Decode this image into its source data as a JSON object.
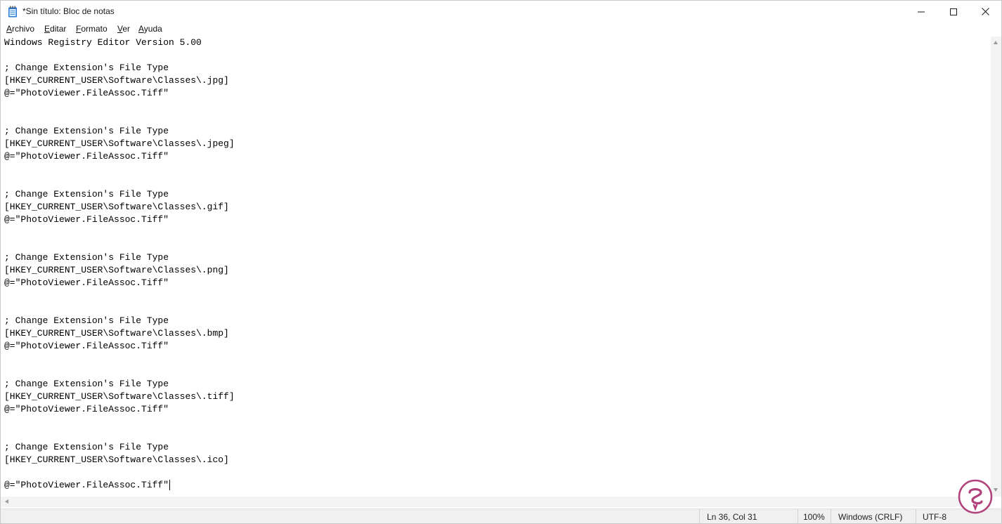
{
  "window": {
    "title": "*Sin título: Bloc de notas"
  },
  "menu": {
    "items": [
      {
        "label": "Archivo",
        "accel": "A",
        "rest": "rchivo"
      },
      {
        "label": "Editar",
        "accel": "E",
        "rest": "ditar"
      },
      {
        "label": "Formato",
        "accel": "F",
        "rest": "ormato"
      },
      {
        "label": "Ver",
        "accel": "V",
        "rest": "er"
      },
      {
        "label": "Ayuda",
        "accel": "A",
        "rest": "yuda"
      }
    ]
  },
  "editor": {
    "lines": [
      "Windows Registry Editor Version 5.00",
      "",
      "; Change Extension's File Type",
      "[HKEY_CURRENT_USER\\Software\\Classes\\.jpg]",
      "@=\"PhotoViewer.FileAssoc.Tiff\"",
      "",
      "",
      "; Change Extension's File Type",
      "[HKEY_CURRENT_USER\\Software\\Classes\\.jpeg]",
      "@=\"PhotoViewer.FileAssoc.Tiff\"",
      "",
      "",
      "; Change Extension's File Type",
      "[HKEY_CURRENT_USER\\Software\\Classes\\.gif]",
      "@=\"PhotoViewer.FileAssoc.Tiff\"",
      "",
      "",
      "; Change Extension's File Type",
      "[HKEY_CURRENT_USER\\Software\\Classes\\.png]",
      "@=\"PhotoViewer.FileAssoc.Tiff\"",
      "",
      "",
      "; Change Extension's File Type",
      "[HKEY_CURRENT_USER\\Software\\Classes\\.bmp]",
      "@=\"PhotoViewer.FileAssoc.Tiff\"",
      "",
      "",
      "; Change Extension's File Type",
      "[HKEY_CURRENT_USER\\Software\\Classes\\.tiff]",
      "@=\"PhotoViewer.FileAssoc.Tiff\"",
      "",
      "",
      "; Change Extension's File Type",
      "[HKEY_CURRENT_USER\\Software\\Classes\\.ico]",
      "",
      "@=\"PhotoViewer.FileAssoc.Tiff\""
    ]
  },
  "status": {
    "position": "Ln 36, Col 31",
    "zoom": "100%",
    "line_ending": "Windows (CRLF)",
    "encoding": "UTF-8"
  },
  "colors": {
    "accent": "#1e6fd9",
    "watermark": "#b0417a"
  },
  "icons": [
    "notepad-icon",
    "minimize-icon",
    "maximize-icon",
    "close-icon",
    "scroll-up-arrow-icon",
    "scroll-down-arrow-icon",
    "scroll-left-arrow-icon",
    "watermark-logo-icon"
  ]
}
